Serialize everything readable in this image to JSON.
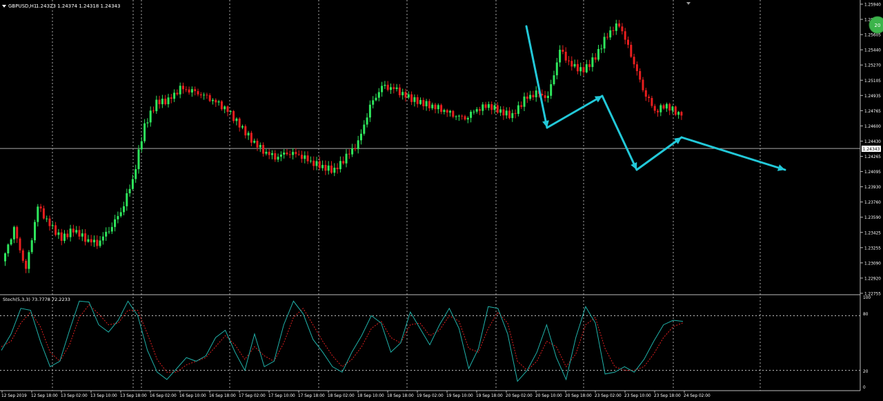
{
  "header": {
    "symbol": "GBPUSD,H1",
    "ohlc": "1.24323 1.24374 1.24318 1.24343"
  },
  "badge": "20",
  "stoch_label": "Stoch(5,3,3) 73.7778 72.2233",
  "current_price": "1.24343",
  "price_ticks": [
    "1.25940",
    "1.25770",
    "1.25605",
    "1.25440",
    "1.25270",
    "1.25105",
    "1.24935",
    "1.24765",
    "1.24600",
    "1.24430",
    "1.24265",
    "1.24095",
    "1.23930",
    "1.23760",
    "1.23590",
    "1.23425",
    "1.23255",
    "1.23090",
    "1.22920",
    "1.22755"
  ],
  "stoch_ticks": [
    "100",
    "80",
    "20",
    "0"
  ],
  "time_ticks": [
    "12 Sep 2019",
    "12 Sep 18:00",
    "13 Sep 02:00",
    "13 Sep 10:00",
    "13 Sep 18:00",
    "16 Sep 02:00",
    "16 Sep 10:00",
    "16 Sep 18:00",
    "17 Sep 02:00",
    "17 Sep 10:00",
    "17 Sep 18:00",
    "18 Sep 02:00",
    "18 Sep 10:00",
    "18 Sep 18:00",
    "19 Sep 02:00",
    "19 Sep 10:00",
    "19 Sep 18:00",
    "20 Sep 02:00",
    "20 Sep 10:00",
    "20 Sep 18:00",
    "23 Sep 02:00",
    "23 Sep 10:00",
    "23 Sep 18:00",
    "24 Sep 02:00"
  ],
  "colors": {
    "bull": "#2ee65c",
    "bear": "#e81e1e",
    "arrow": "#22c8d8",
    "k_line": "#20b2aa",
    "d_line": "#e02020",
    "grid": "#c8c8c8"
  },
  "chart_data": {
    "type": "candlestick",
    "ylim": [
      1.22755,
      1.2594
    ],
    "stoch_ylim": [
      0,
      100
    ],
    "stoch_levels": [
      80,
      20
    ],
    "current_price": 1.24343,
    "price_path": [
      1.231,
      1.2345,
      1.23,
      1.237,
      1.235,
      1.2335,
      1.2345,
      1.2335,
      1.233,
      1.2345,
      1.2365,
      1.24,
      1.246,
      1.2485,
      1.2487,
      1.25,
      1.2497,
      1.2492,
      1.2485,
      1.2476,
      1.246,
      1.2444,
      1.2432,
      1.2425,
      1.243,
      1.2428,
      1.242,
      1.2414,
      1.241,
      1.2425,
      1.244,
      1.248,
      1.2502,
      1.25,
      1.2492,
      1.2486,
      1.2482,
      1.2478,
      1.2472,
      1.2468,
      1.2478,
      1.2482,
      1.2475,
      1.247,
      1.2488,
      1.2495,
      1.249,
      1.2542,
      1.2525,
      1.252,
      1.2535,
      1.256,
      1.2572,
      1.2538,
      1.25,
      1.2476,
      1.2482,
      1.2472,
      1.2478,
      1.2485,
      1.249,
      1.2478,
      1.245,
      1.2428,
      1.242,
      1.2427,
      1.243,
      1.2436,
      1.2432,
      1.2435,
      1.24343
    ],
    "stoch_k": [
      42,
      60,
      88,
      86,
      52,
      24,
      30,
      64,
      96,
      95,
      70,
      62,
      75,
      96,
      80,
      42,
      18,
      10,
      22,
      34,
      30,
      36,
      56,
      64,
      40,
      20,
      60,
      24,
      30,
      70,
      96,
      82,
      54,
      40,
      24,
      18,
      40,
      58,
      80,
      72,
      40,
      50,
      84,
      66,
      48,
      70,
      88,
      66,
      22,
      44,
      90,
      88,
      60,
      8,
      20,
      40,
      70,
      34,
      10,
      56,
      90,
      72,
      16,
      18,
      24,
      18,
      32,
      52,
      70,
      75,
      73.8
    ],
    "stoch_d": [
      46,
      52,
      72,
      84,
      68,
      40,
      30,
      48,
      78,
      92,
      82,
      70,
      72,
      86,
      86,
      60,
      32,
      18,
      18,
      26,
      30,
      34,
      46,
      58,
      48,
      32,
      46,
      36,
      30,
      50,
      78,
      88,
      70,
      52,
      36,
      24,
      32,
      46,
      66,
      74,
      56,
      50,
      70,
      72,
      58,
      64,
      80,
      74,
      44,
      40,
      66,
      84,
      72,
      30,
      20,
      30,
      52,
      46,
      24,
      38,
      70,
      78,
      44,
      24,
      20,
      20,
      24,
      38,
      56,
      68,
      72.2
    ],
    "arrows": [
      {
        "from": [
          "20 Sep 02:00",
          1.2568
        ],
        "to": [
          "20 Sep 10:00",
          1.2458
        ]
      },
      {
        "from": [
          "20 Sep 10:00",
          1.2458
        ],
        "to": [
          "20 Sep 18:00",
          1.2493
        ]
      },
      {
        "from": [
          "20 Sep 18:00",
          1.2493
        ],
        "to": [
          "23 Sep 10:00",
          1.2408
        ]
      },
      {
        "from": [
          "23 Sep 10:00",
          1.2408
        ],
        "to": [
          "23 Sep 18:00",
          1.2448
        ]
      },
      {
        "from": [
          "23 Sep 18:00",
          1.2448
        ],
        "to": [
          "24 Sep 10:00",
          1.2412
        ]
      }
    ]
  }
}
